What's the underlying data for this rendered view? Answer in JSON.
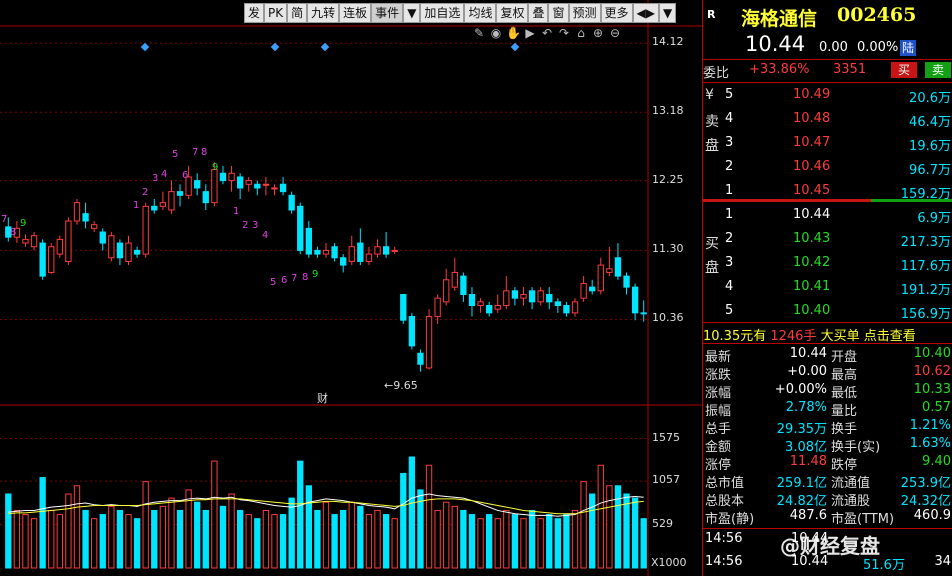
{
  "toolbar": {
    "items": [
      "发",
      "PK",
      "简",
      "九转",
      "连板",
      "事件",
      "▼",
      "加自选",
      "均线",
      "复权",
      "叠",
      "窗",
      "预测",
      "更多",
      "◀▶",
      "▼"
    ]
  },
  "price_axis": [
    "14.12",
    "13.18",
    "12.25",
    "11.30",
    "10.36"
  ],
  "volume_axis": [
    "1575",
    "1057",
    "529"
  ],
  "volume_unit": "X1000",
  "low_marker": "9.65",
  "event_marker": "财",
  "td_counts_top": [
    "1",
    "2",
    "3",
    "4",
    "5",
    "6",
    "7",
    "8",
    "9",
    "1",
    "2",
    "3",
    "4"
  ],
  "td_counts_bottom": [
    "5",
    "6",
    "7",
    "8",
    "9"
  ],
  "td_left": [
    "7",
    "9",
    "8"
  ],
  "stock": {
    "flag": "R",
    "name": "海格通信",
    "code": "002465",
    "price": "10.44",
    "change": "0.00",
    "change_pct": "0.00%",
    "exchange_tag": "陆",
    "weibi_label": "委比",
    "weibi_value": "+33.86%",
    "weicha_value": "3351",
    "sell_btn": "买",
    "buy_btn": "卖"
  },
  "asks": {
    "labels": [
      "¥",
      "卖",
      "盘"
    ],
    "rows": [
      {
        "level": "5",
        "price": "10.49",
        "vol": "20.6万"
      },
      {
        "level": "4",
        "price": "10.48",
        "vol": "46.4万"
      },
      {
        "level": "3",
        "price": "10.47",
        "vol": "19.6万"
      },
      {
        "level": "2",
        "price": "10.46",
        "vol": "96.7万"
      },
      {
        "level": "1",
        "price": "10.45",
        "vol": "159.2万"
      }
    ]
  },
  "bids": {
    "labels": [
      "买",
      "盘"
    ],
    "rows": [
      {
        "level": "1",
        "price": "10.44",
        "vol": "6.9万"
      },
      {
        "level": "2",
        "price": "10.43",
        "vol": "217.3万"
      },
      {
        "level": "3",
        "price": "10.42",
        "vol": "117.6万"
      },
      {
        "level": "4",
        "price": "10.41",
        "vol": "191.2万"
      },
      {
        "level": "5",
        "price": "10.40",
        "vol": "156.9万"
      }
    ]
  },
  "bigorder": {
    "text1": "10.35元有",
    "text2": "1246手",
    "text3": "大买单",
    "text4": "点击查看"
  },
  "stats": [
    {
      "l1": "最新",
      "v1": "10.44",
      "l2": "开盘",
      "v2": "10.40"
    },
    {
      "l1": "涨跌",
      "v1": "+0.00",
      "l2": "最高",
      "v2": "10.62"
    },
    {
      "l1": "涨幅",
      "v1": "+0.00%",
      "l2": "最低",
      "v2": "10.33"
    },
    {
      "l1": "振幅",
      "v1": "2.78%",
      "l2": "量比",
      "v2": "0.57"
    },
    {
      "l1": "总手",
      "v1": "29.35万",
      "l2": "换手",
      "v2": "1.21%"
    },
    {
      "l1": "金额",
      "v1": "3.08亿",
      "l2": "换手(实)",
      "v2": "1.63%"
    },
    {
      "l1": "涨停",
      "v1": "11.48",
      "l2": "跌停",
      "v2": "9.40"
    },
    {
      "l1": "总市值",
      "v1": "259.1亿",
      "l2": "流通值",
      "v2": "253.9亿"
    },
    {
      "l1": "总股本",
      "v1": "24.82亿",
      "l2": "流通股",
      "v2": "24.32亿"
    },
    {
      "l1": "市盈(静)",
      "v1": "487.6",
      "l2": "市盈(TTM)",
      "v2": "460.9"
    }
  ],
  "ticks": [
    {
      "time": "14:56",
      "price": "10.44",
      "vol": "",
      "extra": ""
    },
    {
      "time": "14:56",
      "price": "10.44",
      "vol": "51.6万",
      "extra": "34"
    }
  ],
  "watermark": "@财经复盘",
  "colors": {
    "up": "#ff3b3b",
    "down": "#00e5ff",
    "bg": "#000000",
    "grid": "#b00000",
    "ma5": "#ffffff",
    "ma10": "#ffff33"
  },
  "chart_data": {
    "type": "candlestick",
    "ylim": [
      9.4,
      14.3
    ],
    "volume_ylim": [
      0,
      1800
    ],
    "candles": [
      {
        "o": 11.62,
        "c": 11.48,
        "h": 11.75,
        "l": 11.42
      },
      {
        "o": 11.48,
        "c": 11.6,
        "h": 11.7,
        "l": 11.4
      },
      {
        "o": 11.4,
        "c": 11.45,
        "h": 11.52,
        "l": 11.35
      },
      {
        "o": 11.35,
        "c": 11.5,
        "h": 11.55,
        "l": 11.3
      },
      {
        "o": 11.4,
        "c": 10.95,
        "h": 11.45,
        "l": 10.9
      },
      {
        "o": 11.0,
        "c": 11.35,
        "h": 11.4,
        "l": 10.98
      },
      {
        "o": 11.25,
        "c": 11.45,
        "h": 11.5,
        "l": 11.2
      },
      {
        "o": 11.15,
        "c": 11.7,
        "h": 11.75,
        "l": 11.1
      },
      {
        "o": 11.7,
        "c": 11.95,
        "h": 12.0,
        "l": 11.65
      },
      {
        "o": 11.8,
        "c": 11.7,
        "h": 11.95,
        "l": 11.6
      },
      {
        "o": 11.6,
        "c": 11.65,
        "h": 11.7,
        "l": 11.55
      },
      {
        "o": 11.55,
        "c": 11.4,
        "h": 11.6,
        "l": 11.3
      },
      {
        "o": 11.2,
        "c": 11.5,
        "h": 11.55,
        "l": 11.15
      },
      {
        "o": 11.4,
        "c": 11.2,
        "h": 11.45,
        "l": 11.1
      },
      {
        "o": 11.15,
        "c": 11.4,
        "h": 11.5,
        "l": 11.1
      },
      {
        "o": 11.3,
        "c": 11.25,
        "h": 11.35,
        "l": 11.2
      },
      {
        "o": 11.25,
        "c": 11.9,
        "h": 11.95,
        "l": 11.2
      },
      {
        "o": 11.9,
        "c": 11.85,
        "h": 12.0,
        "l": 11.8
      },
      {
        "o": 11.9,
        "c": 11.95,
        "h": 12.1,
        "l": 11.85
      },
      {
        "o": 11.85,
        "c": 12.1,
        "h": 12.25,
        "l": 11.8
      },
      {
        "o": 12.1,
        "c": 12.05,
        "h": 12.2,
        "l": 11.9
      },
      {
        "o": 12.05,
        "c": 12.3,
        "h": 12.45,
        "l": 12.0
      },
      {
        "o": 12.25,
        "c": 12.15,
        "h": 12.35,
        "l": 12.05
      },
      {
        "o": 12.1,
        "c": 11.95,
        "h": 12.2,
        "l": 11.85
      },
      {
        "o": 11.95,
        "c": 12.4,
        "h": 12.5,
        "l": 11.9
      },
      {
        "o": 12.35,
        "c": 12.25,
        "h": 12.45,
        "l": 12.2
      },
      {
        "o": 12.25,
        "c": 12.35,
        "h": 12.45,
        "l": 12.1
      },
      {
        "o": 12.3,
        "c": 12.15,
        "h": 12.35,
        "l": 12.0
      },
      {
        "o": 12.2,
        "c": 12.25,
        "h": 12.3,
        "l": 12.1
      },
      {
        "o": 12.2,
        "c": 12.15,
        "h": 12.25,
        "l": 12.05
      },
      {
        "o": 12.2,
        "c": 12.2,
        "h": 12.3,
        "l": 12.05
      },
      {
        "o": 12.15,
        "c": 12.15,
        "h": 12.2,
        "l": 12.05
      },
      {
        "o": 12.2,
        "c": 12.1,
        "h": 12.3,
        "l": 12.05
      },
      {
        "o": 12.05,
        "c": 11.85,
        "h": 12.1,
        "l": 11.8
      },
      {
        "o": 11.9,
        "c": 11.3,
        "h": 11.95,
        "l": 11.25
      },
      {
        "o": 11.6,
        "c": 11.25,
        "h": 11.7,
        "l": 11.2
      },
      {
        "o": 11.3,
        "c": 11.25,
        "h": 11.35,
        "l": 11.2
      },
      {
        "o": 11.25,
        "c": 11.3,
        "h": 11.4,
        "l": 11.2
      },
      {
        "o": 11.35,
        "c": 11.2,
        "h": 11.4,
        "l": 11.15
      },
      {
        "o": 11.2,
        "c": 11.1,
        "h": 11.25,
        "l": 11.0
      },
      {
        "o": 11.15,
        "c": 11.35,
        "h": 11.5,
        "l": 11.1
      },
      {
        "o": 11.4,
        "c": 11.15,
        "h": 11.6,
        "l": 11.1
      },
      {
        "o": 11.15,
        "c": 11.25,
        "h": 11.35,
        "l": 11.1
      },
      {
        "o": 11.25,
        "c": 11.35,
        "h": 11.45,
        "l": 11.2
      },
      {
        "o": 11.35,
        "c": 11.25,
        "h": 11.55,
        "l": 11.2
      },
      {
        "o": 11.3,
        "c": 11.3,
        "h": 11.35,
        "l": 11.25
      },
      {
        "o": 10.7,
        "c": 10.35,
        "h": 10.7,
        "l": 10.3
      },
      {
        "o": 10.4,
        "c": 10.0,
        "h": 10.45,
        "l": 9.95
      },
      {
        "o": 9.9,
        "c": 9.75,
        "h": 9.95,
        "l": 9.65
      },
      {
        "o": 9.7,
        "c": 10.4,
        "h": 10.5,
        "l": 9.68
      },
      {
        "o": 10.4,
        "c": 10.65,
        "h": 10.7,
        "l": 10.3
      },
      {
        "o": 10.6,
        "c": 10.9,
        "h": 11.05,
        "l": 10.55
      },
      {
        "o": 10.8,
        "c": 11.0,
        "h": 11.2,
        "l": 10.75
      },
      {
        "o": 10.95,
        "c": 10.7,
        "h": 11.0,
        "l": 10.6
      },
      {
        "o": 10.7,
        "c": 10.55,
        "h": 10.8,
        "l": 10.4
      },
      {
        "o": 10.55,
        "c": 10.6,
        "h": 10.65,
        "l": 10.45
      },
      {
        "o": 10.55,
        "c": 10.45,
        "h": 10.6,
        "l": 10.4
      },
      {
        "o": 10.5,
        "c": 10.55,
        "h": 10.7,
        "l": 10.45
      },
      {
        "o": 10.55,
        "c": 10.75,
        "h": 10.95,
        "l": 10.5
      },
      {
        "o": 10.75,
        "c": 10.65,
        "h": 10.8,
        "l": 10.55
      },
      {
        "o": 10.65,
        "c": 10.7,
        "h": 10.8,
        "l": 10.55
      },
      {
        "o": 10.75,
        "c": 10.6,
        "h": 10.8,
        "l": 10.5
      },
      {
        "o": 10.6,
        "c": 10.75,
        "h": 10.8,
        "l": 10.55
      },
      {
        "o": 10.7,
        "c": 10.6,
        "h": 10.8,
        "l": 10.5
      },
      {
        "o": 10.6,
        "c": 10.55,
        "h": 10.65,
        "l": 10.45
      },
      {
        "o": 10.55,
        "c": 10.45,
        "h": 10.6,
        "l": 10.4
      },
      {
        "o": 10.45,
        "c": 10.6,
        "h": 10.65,
        "l": 10.4
      },
      {
        "o": 10.65,
        "c": 10.85,
        "h": 10.95,
        "l": 10.6
      },
      {
        "o": 10.8,
        "c": 10.75,
        "h": 10.9,
        "l": 10.7
      },
      {
        "o": 10.75,
        "c": 11.1,
        "h": 11.2,
        "l": 10.7
      },
      {
        "o": 11.0,
        "c": 11.05,
        "h": 11.35,
        "l": 10.95
      },
      {
        "o": 11.2,
        "c": 10.95,
        "h": 11.4,
        "l": 10.9
      },
      {
        "o": 10.95,
        "c": 10.8,
        "h": 11.0,
        "l": 10.7
      },
      {
        "o": 10.8,
        "c": 10.45,
        "h": 10.85,
        "l": 10.35
      },
      {
        "o": 10.45,
        "c": 10.44,
        "h": 10.62,
        "l": 10.33
      }
    ],
    "volume": [
      900,
      700,
      650,
      600,
      1100,
      700,
      650,
      900,
      1000,
      700,
      600,
      650,
      750,
      700,
      650,
      600,
      1050,
      700,
      750,
      850,
      700,
      950,
      800,
      700,
      1300,
      750,
      900,
      700,
      650,
      600,
      700,
      650,
      650,
      850,
      1300,
      1000,
      700,
      800,
      650,
      700,
      800,
      750,
      650,
      700,
      650,
      600,
      1150,
      1350,
      950,
      1250,
      700,
      800,
      750,
      700,
      650,
      600,
      650,
      600,
      700,
      650,
      600,
      700,
      600,
      650,
      600,
      650,
      700,
      1050,
      900,
      1250,
      1000,
      1000,
      900,
      850,
      600
    ],
    "ma_white": [
      680,
      690,
      700,
      700,
      720,
      740,
      750,
      760,
      780,
      790,
      770,
      760,
      770,
      760,
      760,
      750,
      780,
      800,
      810,
      820,
      820,
      840,
      850,
      840,
      860,
      850,
      860,
      830,
      820,
      800,
      780,
      760,
      750,
      740,
      760,
      800,
      820,
      840,
      830,
      820,
      800,
      780,
      760,
      750,
      740,
      720,
      780,
      850,
      880,
      900,
      880,
      870,
      860,
      850,
      820,
      780,
      740,
      700,
      680,
      660,
      650,
      640,
      640,
      640,
      630,
      640,
      650,
      700,
      740,
      790,
      820,
      840,
      860,
      870,
      860
    ],
    "ma_yellow": [
      660,
      670,
      670,
      680,
      690,
      700,
      710,
      720,
      740,
      750,
      760,
      760,
      760,
      760,
      760,
      760,
      770,
      780,
      790,
      800,
      810,
      820,
      830,
      830,
      840,
      840,
      840,
      840,
      830,
      820,
      810,
      800,
      790,
      780,
      780,
      790,
      800,
      810,
      810,
      800,
      800,
      790,
      780,
      770,
      760,
      750,
      760,
      790,
      810,
      830,
      840,
      840,
      840,
      830,
      820,
      800,
      780,
      760,
      740,
      720,
      700,
      690,
      680,
      670,
      660,
      660,
      660,
      680,
      700,
      720,
      740,
      760,
      780,
      800,
      810
    ]
  }
}
